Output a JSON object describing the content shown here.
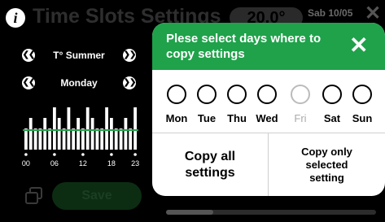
{
  "header": {
    "info_icon": "i",
    "title": "Time Slots Settings",
    "temperature": "20.0°",
    "date": "Sab 10/05",
    "close_icon": "✕"
  },
  "season_selector": {
    "prev": "❮❮",
    "label": "T° Summer",
    "next": "❯❯"
  },
  "day_selector": {
    "prev": "❮❮",
    "label": "Monday",
    "next": "❯❯"
  },
  "chart_data": {
    "type": "bar",
    "hours": [
      0,
      1,
      2,
      3,
      4,
      5,
      6,
      7,
      8,
      9,
      10,
      11,
      12,
      13,
      14,
      15,
      16,
      17,
      18,
      19,
      20,
      21,
      22,
      23
    ],
    "values": [
      2,
      3,
      2,
      2,
      3,
      2,
      4,
      3,
      2,
      4,
      2,
      3,
      2,
      4,
      3,
      2,
      2,
      4,
      3,
      2,
      2,
      3,
      2,
      4
    ],
    "tick_labels": [
      "00",
      "06",
      "12",
      "18",
      "23"
    ],
    "colors": {
      "bar": "#ffffff",
      "threshold_line": "#1fa24a"
    }
  },
  "footer": {
    "save_label": "Save"
  },
  "popup": {
    "title": "Plese select days where to copy settings",
    "close_icon": "✕",
    "days": [
      {
        "label": "Mon",
        "enabled": true
      },
      {
        "label": "Tue",
        "enabled": true
      },
      {
        "label": "Thu",
        "enabled": true
      },
      {
        "label": "Wed",
        "enabled": true
      },
      {
        "label": "Fri",
        "enabled": false
      },
      {
        "label": "Sat",
        "enabled": true
      },
      {
        "label": "Sun",
        "enabled": true
      }
    ],
    "copy_all_label": "Copy all\nsettings",
    "copy_selected_label": "Copy only\nselected\nsetting"
  },
  "colors": {
    "accent_green": "#1fa24a",
    "background": "#000000",
    "popup_background": "#ffffff"
  }
}
